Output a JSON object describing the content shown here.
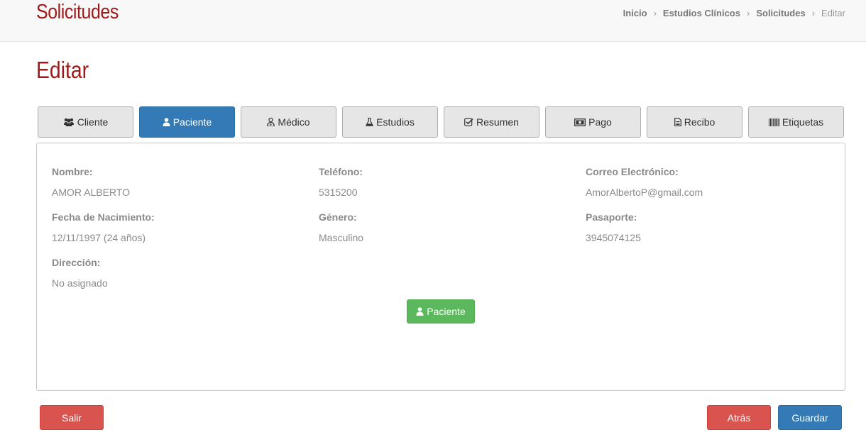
{
  "header": {
    "app_title": "Solicitudes",
    "breadcrumb": [
      {
        "label": "Inicio"
      },
      {
        "label": "Estudios Clínicos"
      },
      {
        "label": "Solicitudes"
      },
      {
        "label": "Editar"
      }
    ]
  },
  "page": {
    "title": "Editar"
  },
  "tabs": [
    {
      "label": "Cliente",
      "icon": "users-icon"
    },
    {
      "label": "Paciente",
      "icon": "user-icon",
      "active": true
    },
    {
      "label": "Médico",
      "icon": "user-md-icon"
    },
    {
      "label": "Estudios",
      "icon": "flask-icon"
    },
    {
      "label": "Resumen",
      "icon": "check-square-icon"
    },
    {
      "label": "Pago",
      "icon": "money-icon"
    },
    {
      "label": "Recibo",
      "icon": "file-text-icon"
    },
    {
      "label": "Etiquetas",
      "icon": "barcode-icon"
    }
  ],
  "patient": {
    "nombre": {
      "label": "Nombre:",
      "value": "AMOR ALBERTO"
    },
    "telefono": {
      "label": "Teléfono:",
      "value": "5315200"
    },
    "correo": {
      "label": "Correo Electrónico:",
      "value": "AmorAlbertoP@gmail.com"
    },
    "nacimiento": {
      "label": "Fecha de Nacimiento:",
      "value": "12/11/1997 (24 años)"
    },
    "genero": {
      "label": "Género:",
      "value": "Masculino"
    },
    "pasaporte": {
      "label": "Pasaporte:",
      "value": "3945074125"
    },
    "direccion": {
      "label": "Dirección:",
      "value": "No asignado"
    }
  },
  "panel_button": {
    "label": "Paciente",
    "icon": "user-icon"
  },
  "footer": {
    "salir": "Salir",
    "atras": "Atrás",
    "guardar": "Guardar"
  },
  "colors": {
    "title_red": "#a01a1a",
    "primary": "#337ab7",
    "success": "#5cb85c",
    "danger": "#d9534f"
  }
}
